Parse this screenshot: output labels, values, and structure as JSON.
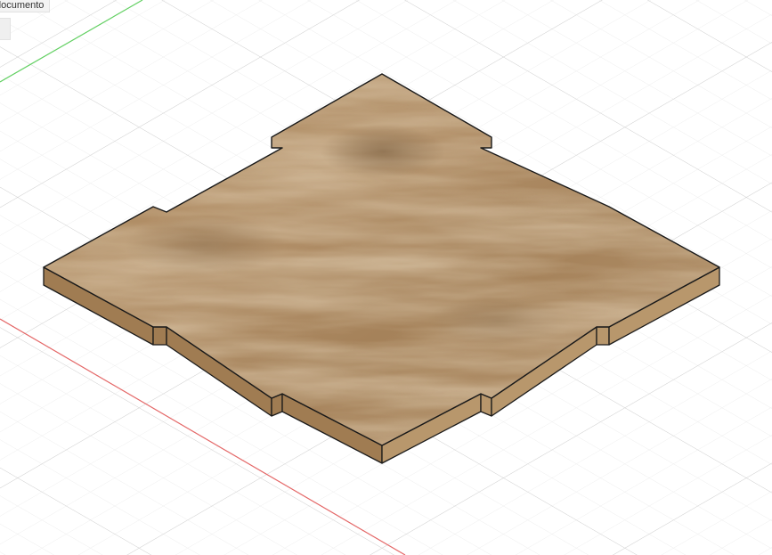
{
  "document": {
    "tab_label": "documento"
  },
  "viewport": {
    "background": "#ffffff",
    "grid_major_color": "#d2d2d2",
    "grid_minor_color": "#ebebeb",
    "axis_x_color": "#e35b5b",
    "axis_y_color": "#5fd35f"
  },
  "model": {
    "name": "wooden-plate",
    "material": "wood",
    "top_color": "#b08d62",
    "side_color": "#a07c52",
    "edge_color": "#1a1a1a"
  }
}
